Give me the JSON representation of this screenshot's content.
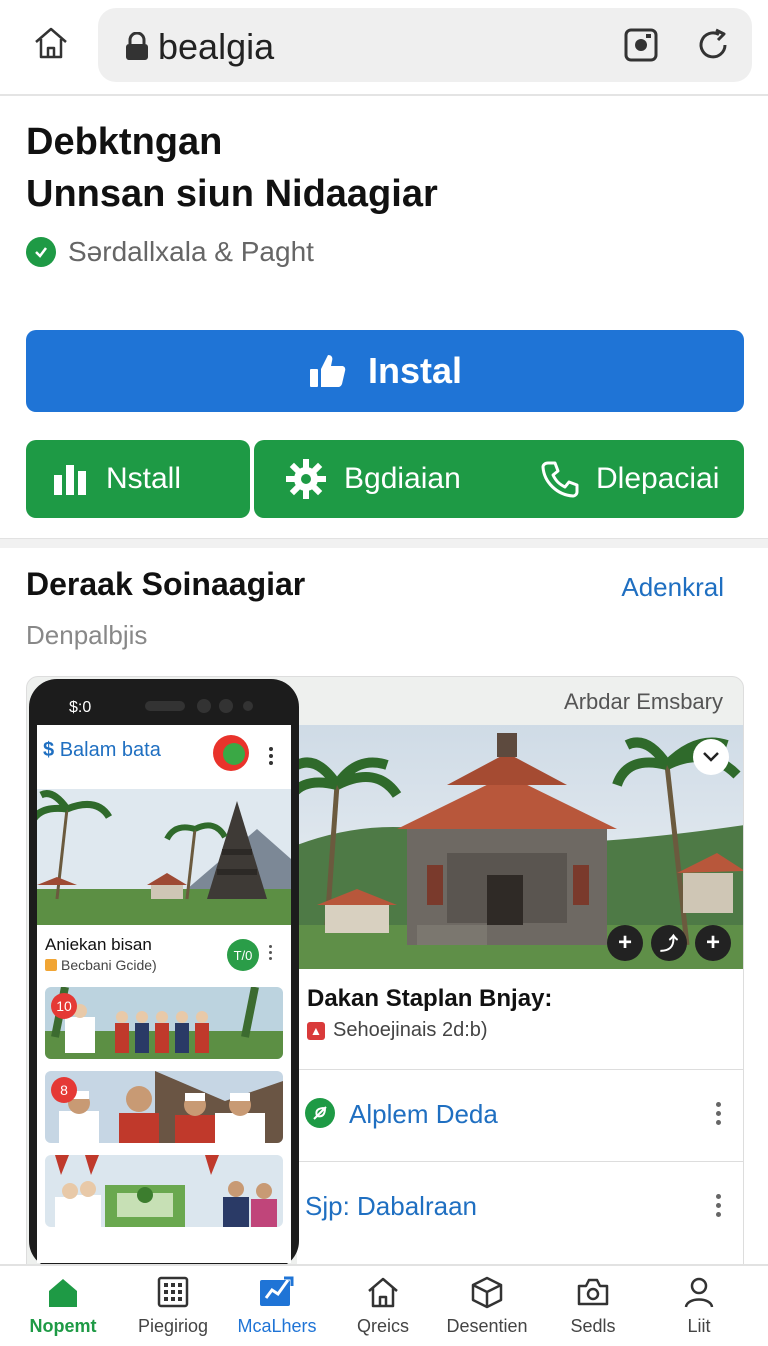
{
  "browser": {
    "url": "bealgia"
  },
  "app": {
    "title_line1": "Debktngan",
    "title_line2": "Unnsan siun Nidaagiar",
    "publisher": "Sərdallxala & Paght",
    "install_label": "Instal",
    "secondary_buttons": [
      "Nstall",
      "Bgdiaian",
      "Dlepaciai"
    ]
  },
  "section": {
    "title": "Deraak Soinaagiar",
    "link": "Adenkral",
    "subtitle": "Denpalbjis"
  },
  "card": {
    "caption": "Arbdar Emsbary",
    "info_title": "Dakan Staplan Bnjay:",
    "info_sub": "Sehoejinais 2d:b)",
    "rows": [
      "Alplem Deda",
      "Sjp: Dabalraan"
    ]
  },
  "phone": {
    "status": "$:0",
    "header": "Balam bata",
    "item_title": "Aniekan bisan",
    "item_sub": "Becbani Gcide)",
    "pill": "T/0",
    "thumb_badges": [
      "10",
      "8"
    ]
  },
  "bottom_nav": [
    {
      "label": "Nopemt",
      "icon": "home-icon",
      "active": true
    },
    {
      "label": "Piegiriog",
      "icon": "grid-icon",
      "active": false
    },
    {
      "label": "McaLhers",
      "icon": "chart-icon",
      "active": false,
      "accent": true
    },
    {
      "label": "Qreics",
      "icon": "house-icon",
      "active": false
    },
    {
      "label": "Desentien",
      "icon": "box-icon",
      "active": false
    },
    {
      "label": "Sedls",
      "icon": "camera-icon",
      "active": false
    },
    {
      "label": "Liit",
      "icon": "person-icon",
      "active": false
    }
  ],
  "colors": {
    "install_blue": "#1f74d6",
    "action_green": "#1e9a45",
    "link_blue": "#1f6fc1"
  }
}
